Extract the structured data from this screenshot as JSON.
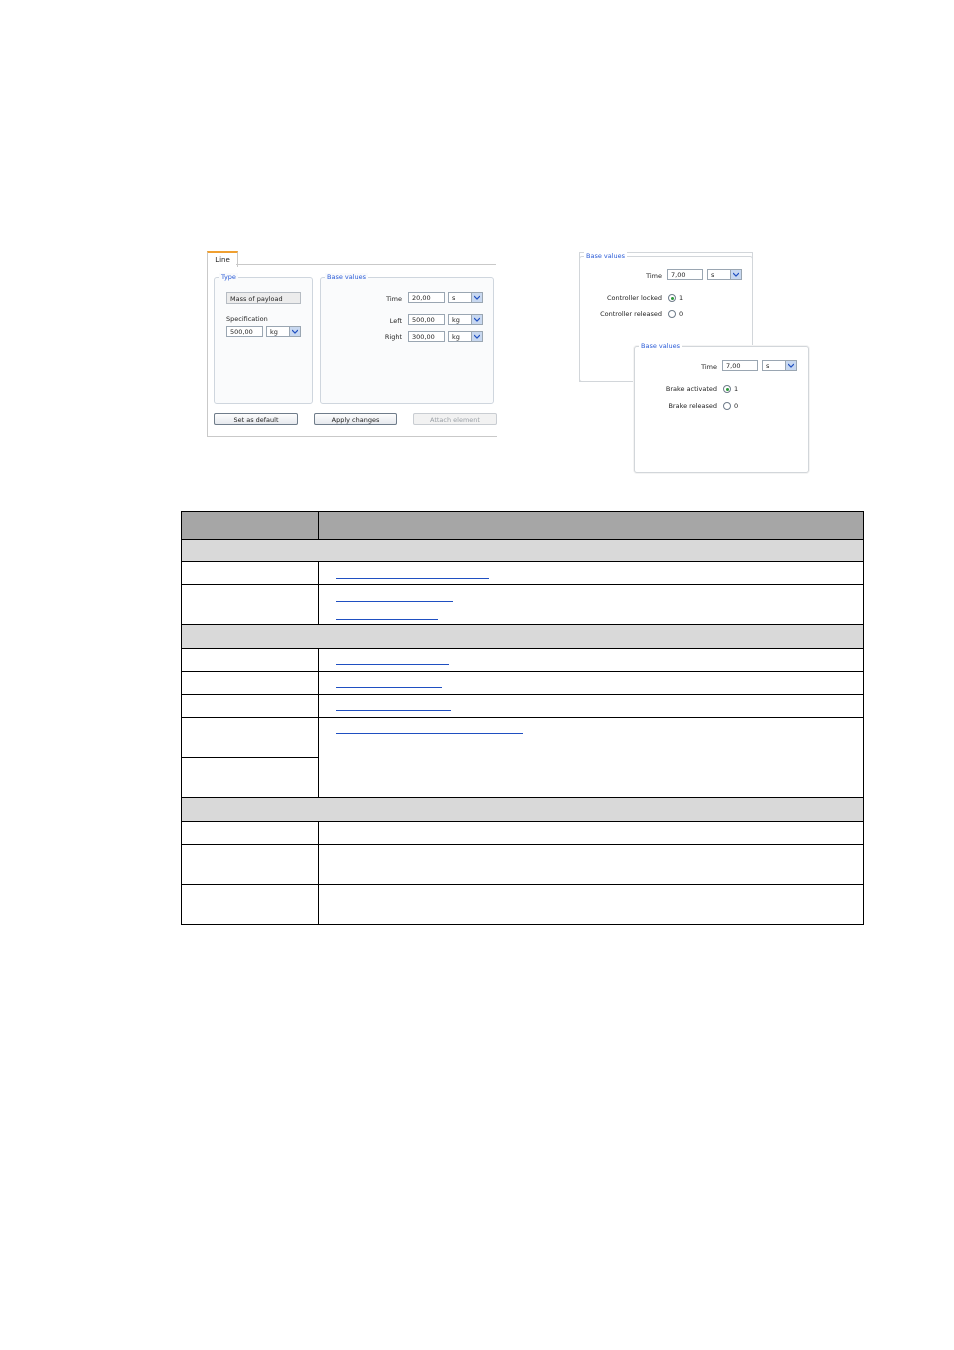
{
  "line_panel": {
    "tab_label": "Line",
    "type_group": {
      "legend": "Type",
      "selected_type": "Mass of payload",
      "specification_label": "Specification",
      "specification_value": "500,00",
      "specification_unit": "kg"
    },
    "base_values": {
      "legend": "Base values",
      "time_label": "Time",
      "time_value": "20,00",
      "time_unit": "s",
      "left_label": "Left",
      "left_value": "500,00",
      "left_unit": "kg",
      "right_label": "Right",
      "right_value": "300,00",
      "right_unit": "kg"
    },
    "buttons": {
      "set_default": "Set as default",
      "apply_changes": "Apply changes",
      "attach_element": "Attach element"
    }
  },
  "controller_panel": {
    "legend": "Base values",
    "time_label": "Time",
    "time_value": "7,00",
    "time_unit": "s",
    "locked_label": "Controller locked",
    "locked_value": "1",
    "released_label": "Controller released",
    "released_value": "0",
    "selected": "locked"
  },
  "brake_panel": {
    "legend": "Base values",
    "time_label": "Time",
    "time_value": "7,00",
    "time_unit": "s",
    "activated_label": "Brake activated",
    "activated_value": "1",
    "released_label": "Brake released",
    "released_value": "0",
    "selected": "activated"
  },
  "colors": {
    "tab_accent": "#f0a030",
    "legend_text": "#2a5bd7",
    "table_header": "#a6a6a6",
    "table_section": "#d9d9d9",
    "link": "#1f4fc1"
  }
}
